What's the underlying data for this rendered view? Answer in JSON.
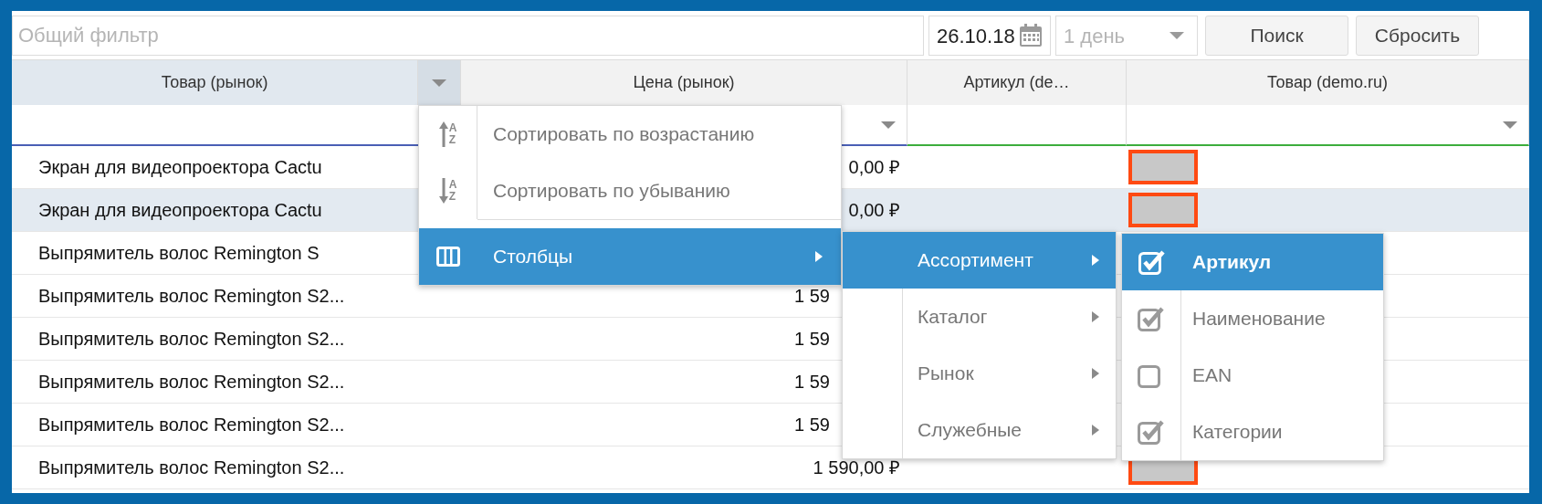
{
  "filter": {
    "placeholder": "Общий фильтр"
  },
  "date": {
    "value": "26.10.18"
  },
  "period": {
    "value": "1 день",
    "disabled": true
  },
  "buttons": [
    "Поиск",
    "Сбросить"
  ],
  "table": {
    "columns": [
      {
        "label": "Товар (рынок)",
        "selected": true,
        "filter_dropdown": false
      },
      {
        "label": "Цена (рынок)",
        "selected": false,
        "filter_dropdown": true
      },
      {
        "label": "Артикул (de…",
        "selected": false,
        "filter_dropdown": false
      },
      {
        "label": "Товар (demo.ru)",
        "selected": false,
        "filter_dropdown": true
      }
    ],
    "rows": [
      {
        "selected": false,
        "product": "Экран для видеопроектора Cactu",
        "price": "0,00 ₽",
        "image": true
      },
      {
        "selected": true,
        "product": "Экран для видеопроектора Cactu",
        "price": "0,00 ₽",
        "image": true
      },
      {
        "selected": false,
        "product": "Выпрямитель волос Remington S",
        "image": false
      },
      {
        "selected": false,
        "product": "Выпрямитель волос Remington S2...",
        "price": "1 59",
        "price_cut_off": true,
        "image": false
      },
      {
        "selected": false,
        "product": "Выпрямитель волос Remington S2...",
        "price": "1 59",
        "price_cut_off": true,
        "image": false
      },
      {
        "selected": false,
        "product": "Выпрямитель волос Remington S2...",
        "price": "1 59",
        "price_cut_off": true,
        "image": false
      },
      {
        "selected": false,
        "product": "Выпрямитель волос Remington S2...",
        "price": "1 59",
        "price_cut_off": true,
        "image": false
      },
      {
        "selected": false,
        "product": "Выпрямитель волос Remington S2...",
        "price": "1 590,00 ₽",
        "image": true
      }
    ]
  },
  "context_menu": {
    "items": [
      {
        "kind": "sort_asc",
        "label": "Сортировать по возрастанию",
        "icon_glyphs": [
          "A",
          "Z"
        ],
        "selected": false
      },
      {
        "kind": "sort_desc",
        "label": "Сортировать по убыванию",
        "icon_glyphs": [
          "A",
          "Z"
        ],
        "selected": false
      },
      {
        "kind": "columns",
        "label": "Столбцы",
        "selected": true
      }
    ]
  },
  "columns_submenu": {
    "items": [
      {
        "label": "Ассортимент",
        "selected": true
      },
      {
        "label": "Каталог",
        "selected": false
      },
      {
        "label": "Рынок",
        "selected": false
      },
      {
        "label": "Служебные",
        "selected": false
      }
    ]
  },
  "assortment_submenu": {
    "items": [
      {
        "label": "Артикул",
        "checked": true,
        "selected": true
      },
      {
        "label": "Наименование",
        "checked": true,
        "selected": false
      },
      {
        "label": "EAN",
        "checked": false,
        "selected": false
      },
      {
        "label": "Категории",
        "checked": true,
        "selected": false
      }
    ]
  }
}
